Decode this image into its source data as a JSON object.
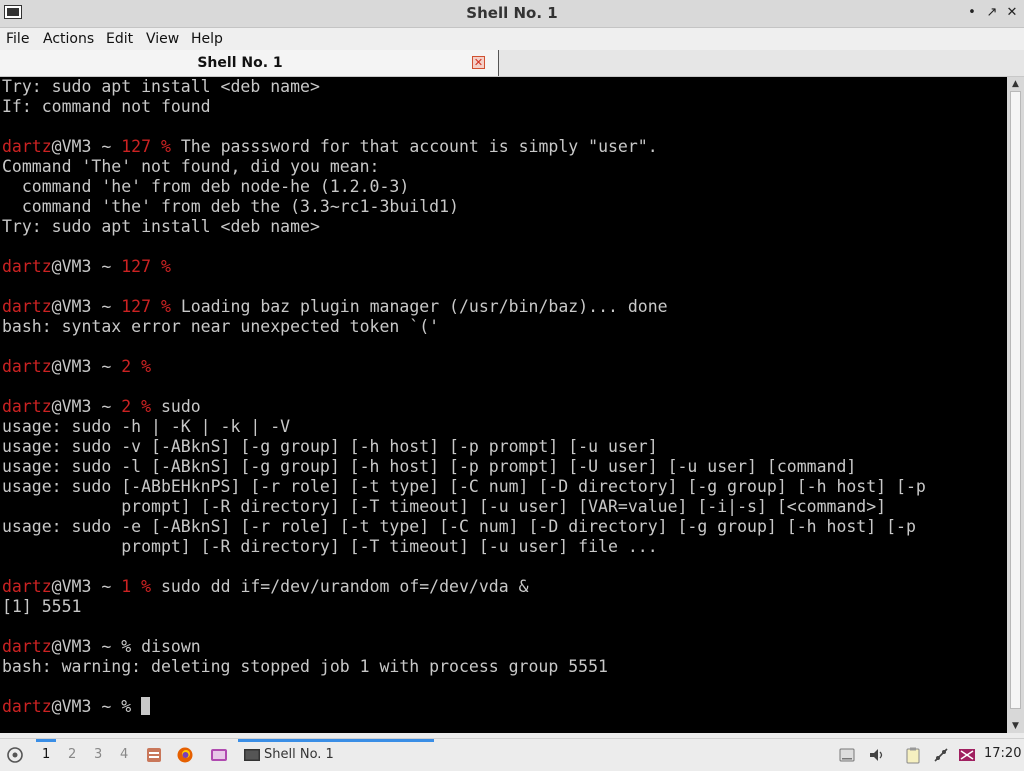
{
  "window": {
    "title": "Shell No. 1",
    "buttons": {
      "minimize": "•",
      "maximize": "↗",
      "close": "✕"
    }
  },
  "menu": [
    "File",
    "Actions",
    "Edit",
    "View",
    "Help"
  ],
  "tab": {
    "label": "Shell No. 1",
    "close": "✕"
  },
  "prompt": {
    "user": "dartz",
    "rest": "@VM3 ~ ",
    "suffix": "%"
  },
  "terminal": {
    "lines": [
      {
        "kind": "text",
        "text": "Try: sudo apt install <deb name>"
      },
      {
        "kind": "text",
        "text": "If: command not found"
      },
      {
        "kind": "blank"
      },
      {
        "kind": "prompt",
        "code": "127",
        "cmd": "The passsword for that account is simply \"user\"."
      },
      {
        "kind": "text",
        "text": "Command 'The' not found, did you mean:"
      },
      {
        "kind": "text",
        "text": "  command 'he' from deb node-he (1.2.0-3)"
      },
      {
        "kind": "text",
        "text": "  command 'the' from deb the (3.3~rc1-3build1)"
      },
      {
        "kind": "text",
        "text": "Try: sudo apt install <deb name>"
      },
      {
        "kind": "blank"
      },
      {
        "kind": "prompt",
        "code": "127",
        "cmd": ""
      },
      {
        "kind": "blank"
      },
      {
        "kind": "prompt",
        "code": "127",
        "cmd": "Loading baz plugin manager (/usr/bin/baz)... done"
      },
      {
        "kind": "text",
        "text": "bash: syntax error near unexpected token `('"
      },
      {
        "kind": "blank"
      },
      {
        "kind": "prompt",
        "code": "2",
        "cmd": ""
      },
      {
        "kind": "blank"
      },
      {
        "kind": "prompt",
        "code": "2",
        "cmd": "sudo"
      },
      {
        "kind": "text",
        "text": "usage: sudo -h | -K | -k | -V"
      },
      {
        "kind": "text",
        "text": "usage: sudo -v [-ABknS] [-g group] [-h host] [-p prompt] [-u user]"
      },
      {
        "kind": "text",
        "text": "usage: sudo -l [-ABknS] [-g group] [-h host] [-p prompt] [-U user] [-u user] [command]"
      },
      {
        "kind": "text",
        "text": "usage: sudo [-ABbEHknPS] [-r role] [-t type] [-C num] [-D directory] [-g group] [-h host] [-p"
      },
      {
        "kind": "text",
        "text": "            prompt] [-R directory] [-T timeout] [-u user] [VAR=value] [-i|-s] [<command>]"
      },
      {
        "kind": "text",
        "text": "usage: sudo -e [-ABknS] [-r role] [-t type] [-C num] [-D directory] [-g group] [-h host] [-p"
      },
      {
        "kind": "text",
        "text": "            prompt] [-R directory] [-T timeout] [-u user] file ..."
      },
      {
        "kind": "blank"
      },
      {
        "kind": "prompt",
        "code": "1",
        "cmd": "sudo dd if=/dev/urandom of=/dev/vda &"
      },
      {
        "kind": "text",
        "text": "[1] 5551"
      },
      {
        "kind": "blank"
      },
      {
        "kind": "prompt",
        "code": "",
        "cmd": "disown"
      },
      {
        "kind": "text",
        "text": "bash: warning: deleting stopped job 1 with process group 5551"
      },
      {
        "kind": "blank"
      },
      {
        "kind": "prompt",
        "code": "",
        "cmd": "",
        "cursor": true
      }
    ]
  },
  "taskbar": {
    "workspaces": [
      "1",
      "2",
      "3",
      "4"
    ],
    "active_workspace": "1",
    "task": "Shell No. 1",
    "clock": "17:20"
  }
}
